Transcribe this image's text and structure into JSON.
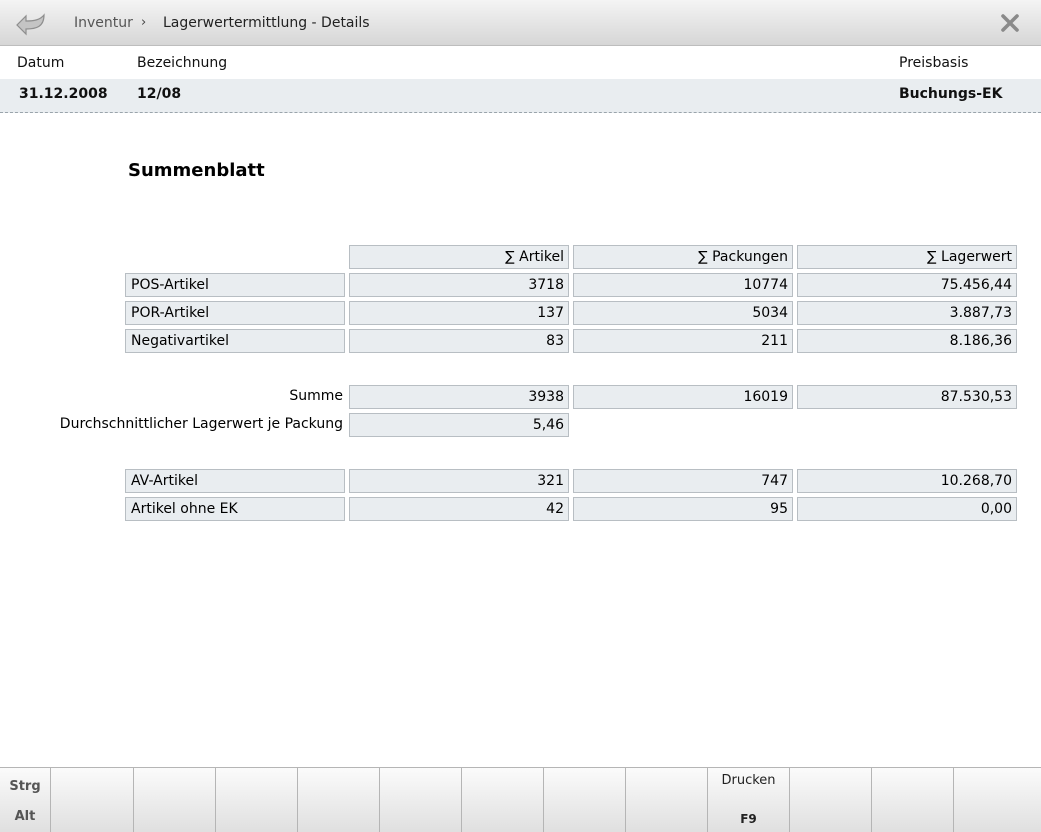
{
  "breadcrumb": {
    "root": "Inventur",
    "separator": "›",
    "current": "Lagerwertermittlung - Details"
  },
  "header": {
    "labels": {
      "datum": "Datum",
      "bezeichnung": "Bezeichnung",
      "preisbasis": "Preisbasis"
    },
    "values": {
      "datum": "31.12.2008",
      "bezeichnung": "12/08",
      "preisbasis": "Buchungs-EK"
    }
  },
  "section_title": "Summenblatt",
  "table": {
    "columns": [
      "∑ Artikel",
      "∑ Packungen",
      "∑ Lagerwert"
    ],
    "rows": [
      {
        "label": "POS-Artikel",
        "values": [
          "3718",
          "10774",
          "75.456,44"
        ]
      },
      {
        "label": "POR-Artikel",
        "values": [
          "137",
          "5034",
          "3.887,73"
        ]
      },
      {
        "label": "Negativartikel",
        "values": [
          "83",
          "211",
          "8.186,36"
        ]
      }
    ],
    "summe": {
      "label": "Summe",
      "values": [
        "3938",
        "16019",
        "87.530,53"
      ]
    },
    "durchschnitt": {
      "label": "Durchschnittlicher Lagerwert je Packung",
      "value": "5,46"
    },
    "extra_rows": [
      {
        "label": "AV-Artikel",
        "values": [
          "321",
          "747",
          "10.268,70"
        ]
      },
      {
        "label": "Artikel ohne EK",
        "values": [
          "42",
          "95",
          "0,00"
        ]
      }
    ]
  },
  "fkeys": {
    "modifier": {
      "line1": "Strg",
      "line2": "Alt"
    },
    "drucken": {
      "label": "Drucken",
      "key": "F9"
    }
  },
  "colors": {
    "cell_bg": "#e9edf0",
    "cell_border": "#b8bec3",
    "header_row_bg": "#e9edf0"
  }
}
